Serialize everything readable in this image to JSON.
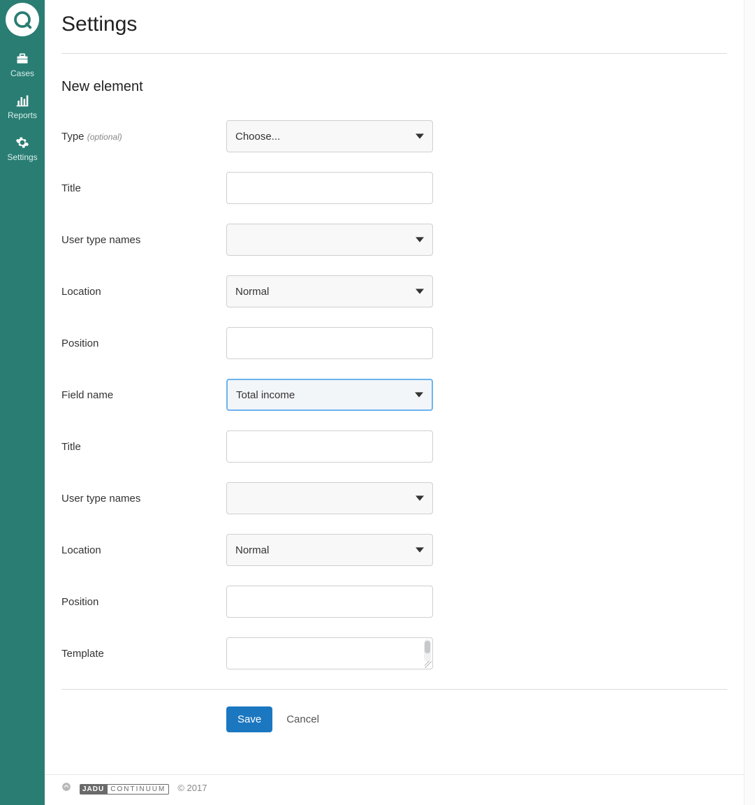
{
  "sidebar": {
    "items": [
      {
        "label": "Cases"
      },
      {
        "label": "Reports"
      },
      {
        "label": "Settings"
      }
    ]
  },
  "page": {
    "title": "Settings",
    "section_title": "New element"
  },
  "form": {
    "type_label": "Type",
    "type_optional": "(optional)",
    "type_value": "Choose...",
    "title1_label": "Title",
    "title1_value": "",
    "usertypes1_label": "User type names",
    "usertypes1_value": "",
    "location1_label": "Location",
    "location1_value": "Normal",
    "position1_label": "Position",
    "position1_value": "",
    "fieldname_label": "Field name",
    "fieldname_value": "Total income",
    "title2_label": "Title",
    "title2_value": "",
    "usertypes2_label": "User type names",
    "usertypes2_value": "",
    "location2_label": "Location",
    "location2_value": "Normal",
    "position2_label": "Position",
    "position2_value": "",
    "template_label": "Template",
    "template_value": ""
  },
  "actions": {
    "save": "Save",
    "cancel": "Cancel"
  },
  "footer": {
    "brand1": "JADU",
    "brand2": "CONTINUUM",
    "copyright": "© 2017"
  }
}
